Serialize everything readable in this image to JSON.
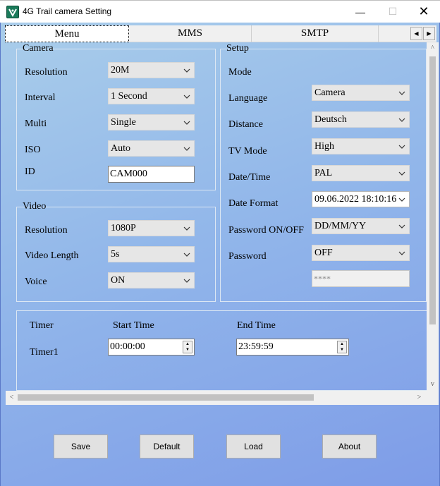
{
  "window": {
    "title": "4G Trail camera Setting",
    "minimize_glyph": "—",
    "maximize_glyph": "☐",
    "close_glyph": "✕"
  },
  "tabs": [
    {
      "label": "Menu"
    },
    {
      "label": "MMS"
    },
    {
      "label": "SMTP"
    }
  ],
  "tab_scroll": {
    "left": "◀",
    "right": "▶"
  },
  "camera": {
    "legend": "Camera",
    "resolution": {
      "label": "Resolution",
      "value": "20M"
    },
    "interval": {
      "label": "Interval",
      "value": "1 Second"
    },
    "multi": {
      "label": "Multi",
      "value": "Single"
    },
    "iso": {
      "label": "ISO",
      "value": "Auto"
    },
    "id": {
      "label": "ID",
      "value": "CAM000"
    }
  },
  "video": {
    "legend": "Video",
    "resolution": {
      "label": "Resolution",
      "value": "1080P"
    },
    "length": {
      "label": "Video Length",
      "value": "5s"
    },
    "voice": {
      "label": "Voice",
      "value": "ON"
    }
  },
  "setup": {
    "legend": "Setup",
    "mode": {
      "label": "Mode",
      "value": "Camera"
    },
    "language": {
      "label": "Language",
      "value": "Deutsch"
    },
    "distance": {
      "label": "Distance",
      "value": "High"
    },
    "tv_mode": {
      "label": "TV Mode",
      "value": "PAL"
    },
    "datetime": {
      "label": "Date/Time",
      "value": "09.06.2022 18:10:16"
    },
    "date_format": {
      "label": "Date Format",
      "value": "DD/MM/YY"
    },
    "password_onoff": {
      "label": "Password ON/OFF",
      "value": "OFF"
    },
    "password": {
      "label": "Password",
      "value": "****"
    }
  },
  "timer": {
    "header": "Timer",
    "start_header": "Start Time",
    "end_header": "End Time",
    "rows": [
      {
        "label": "Timer1",
        "start": "00:00:00",
        "end": "23:59:59"
      }
    ]
  },
  "buttons": {
    "save": "Save",
    "default": "Default",
    "load": "Load",
    "about": "About"
  },
  "scroll_glyphs": {
    "up": "^",
    "down": "v",
    "left": "<",
    "right": ">"
  },
  "colors": {
    "bg_gradient_start": "#a9cdea",
    "bg_gradient_end": "#7e9ce8",
    "app_icon": "#1a7a5a"
  }
}
